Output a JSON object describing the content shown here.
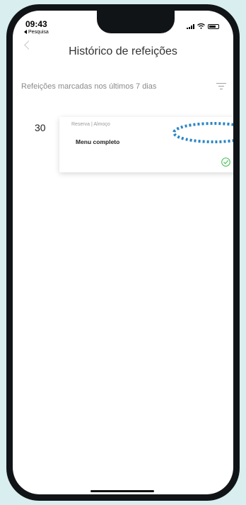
{
  "status_bar": {
    "time": "09:43",
    "back_app": "Pesquisa"
  },
  "header": {
    "back_icon": "chevron-left-icon",
    "title": "Histórico de refeições"
  },
  "subheader": {
    "text": "Refeições marcadas nos últimos 7 dias",
    "filter_icon": "filter-icon"
  },
  "meals": [
    {
      "day": "30",
      "meta": "Reserva | Almoço",
      "title": "Menu completo",
      "status_icon": "check-circle-icon"
    }
  ],
  "colors": {
    "accent_green": "#3cbf4c",
    "highlight_blue": "#2b86c5",
    "phone_frame": "#111417",
    "background": "#d9eeee"
  }
}
